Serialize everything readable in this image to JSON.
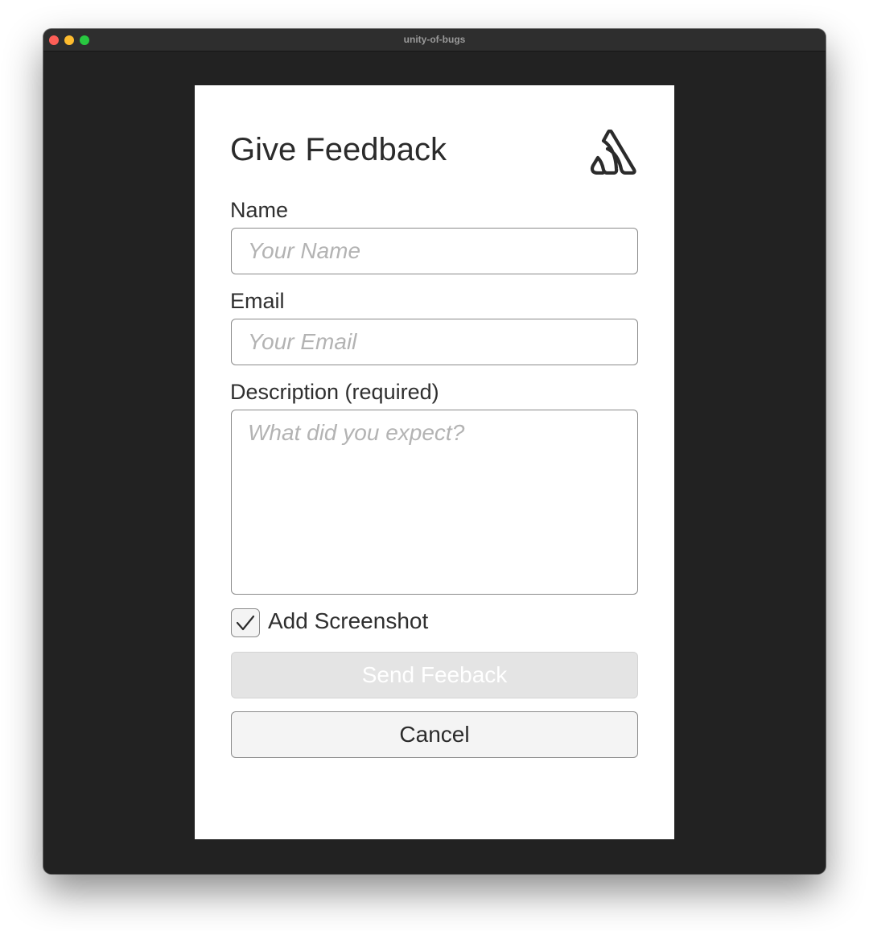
{
  "window": {
    "title": "unity-of-bugs"
  },
  "form": {
    "heading": "Give Feedback",
    "logo_icon": "sentry-logo-icon",
    "name": {
      "label": "Name",
      "placeholder": "Your Name",
      "value": ""
    },
    "email": {
      "label": "Email",
      "placeholder": "Your Email",
      "value": ""
    },
    "description": {
      "label": "Description (required)",
      "placeholder": "What did you expect?",
      "value": ""
    },
    "screenshot": {
      "label": "Add Screenshot",
      "checked": true
    },
    "send_label": "Send Feeback",
    "cancel_label": "Cancel"
  },
  "colors": {
    "window_background": "#222222",
    "panel_background": "#ffffff",
    "disabled_button": "#e4e4e4"
  }
}
